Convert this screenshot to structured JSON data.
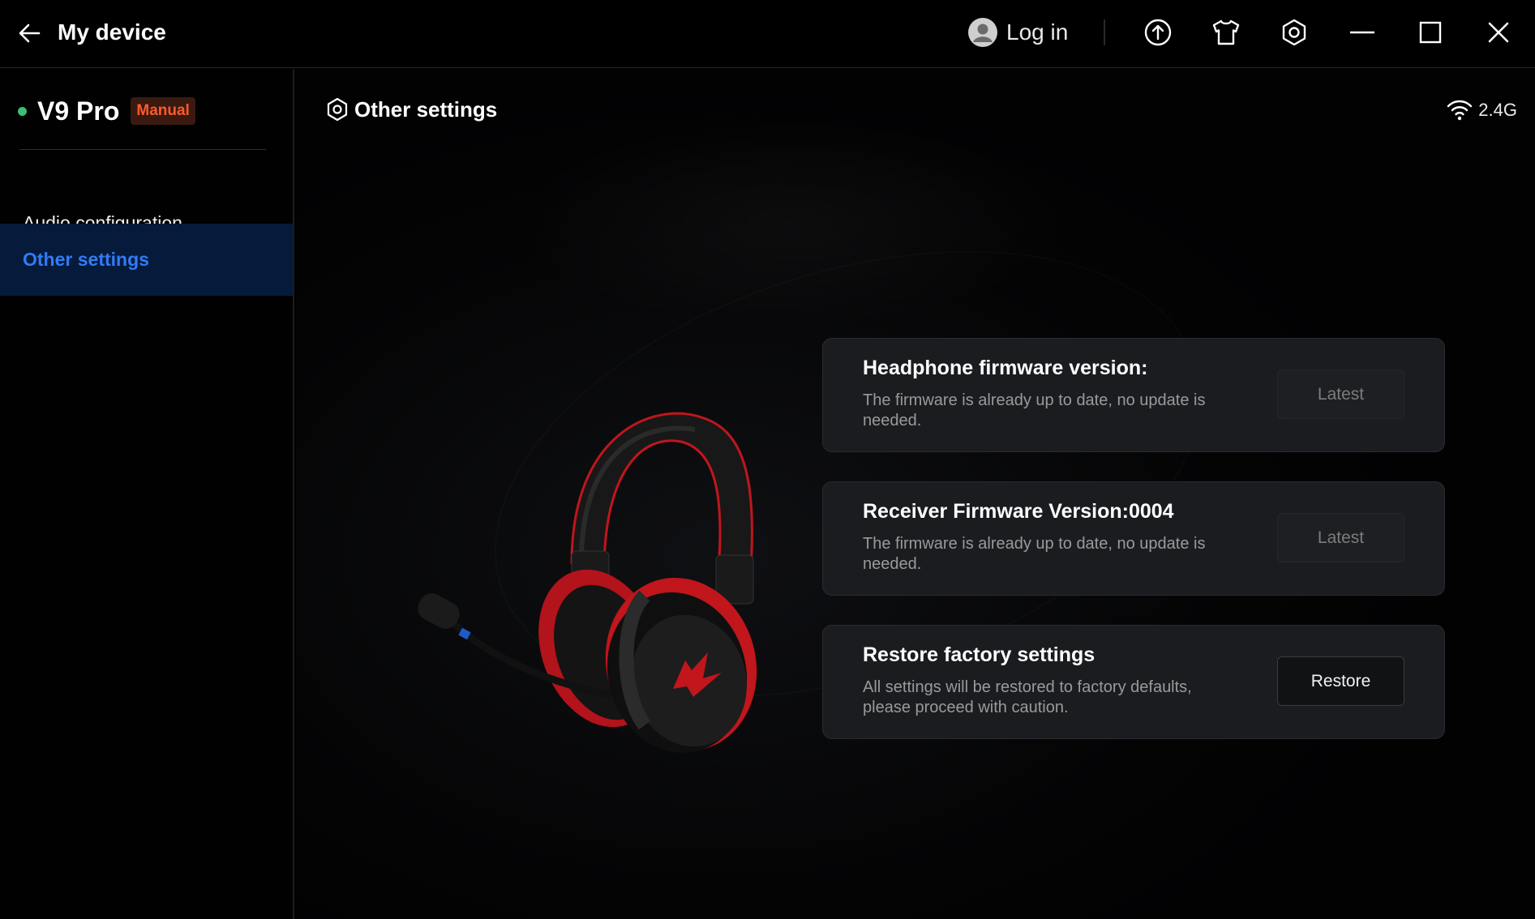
{
  "titlebar": {
    "title": "My device",
    "login_label": "Log in",
    "icons": [
      "back-arrow-icon",
      "user-avatar-icon",
      "upload-icon",
      "tshirt-skin-icon",
      "settings-hex-icon",
      "minimize-icon",
      "maximize-icon",
      "close-icon"
    ]
  },
  "sidebar": {
    "device_name": "V9 Pro",
    "mode_badge": "Manual",
    "status_color": "#3bbf74",
    "items": [
      {
        "label": "Audio configuration",
        "active": false
      },
      {
        "label": "Other settings",
        "active": true
      }
    ]
  },
  "main": {
    "section_title": "Other settings",
    "connection": "2.4G",
    "cards": [
      {
        "title": "Headphone firmware version:",
        "description": "The firmware is already up to date, no update is needed.",
        "button": "Latest",
        "button_enabled": false
      },
      {
        "title": "Receiver Firmware Version:0004",
        "description": "The firmware is already up to date, no update is needed.",
        "button": "Latest",
        "button_enabled": false
      },
      {
        "title": "Restore factory settings",
        "description": "All settings will be restored to factory defaults, please proceed with caution.",
        "button": "Restore",
        "button_enabled": true
      }
    ]
  },
  "colors": {
    "accent": "#2f7cf6",
    "active_bg": "#061a3c",
    "badge_text": "#ff5a2a",
    "headset_red": "#c0161c"
  }
}
